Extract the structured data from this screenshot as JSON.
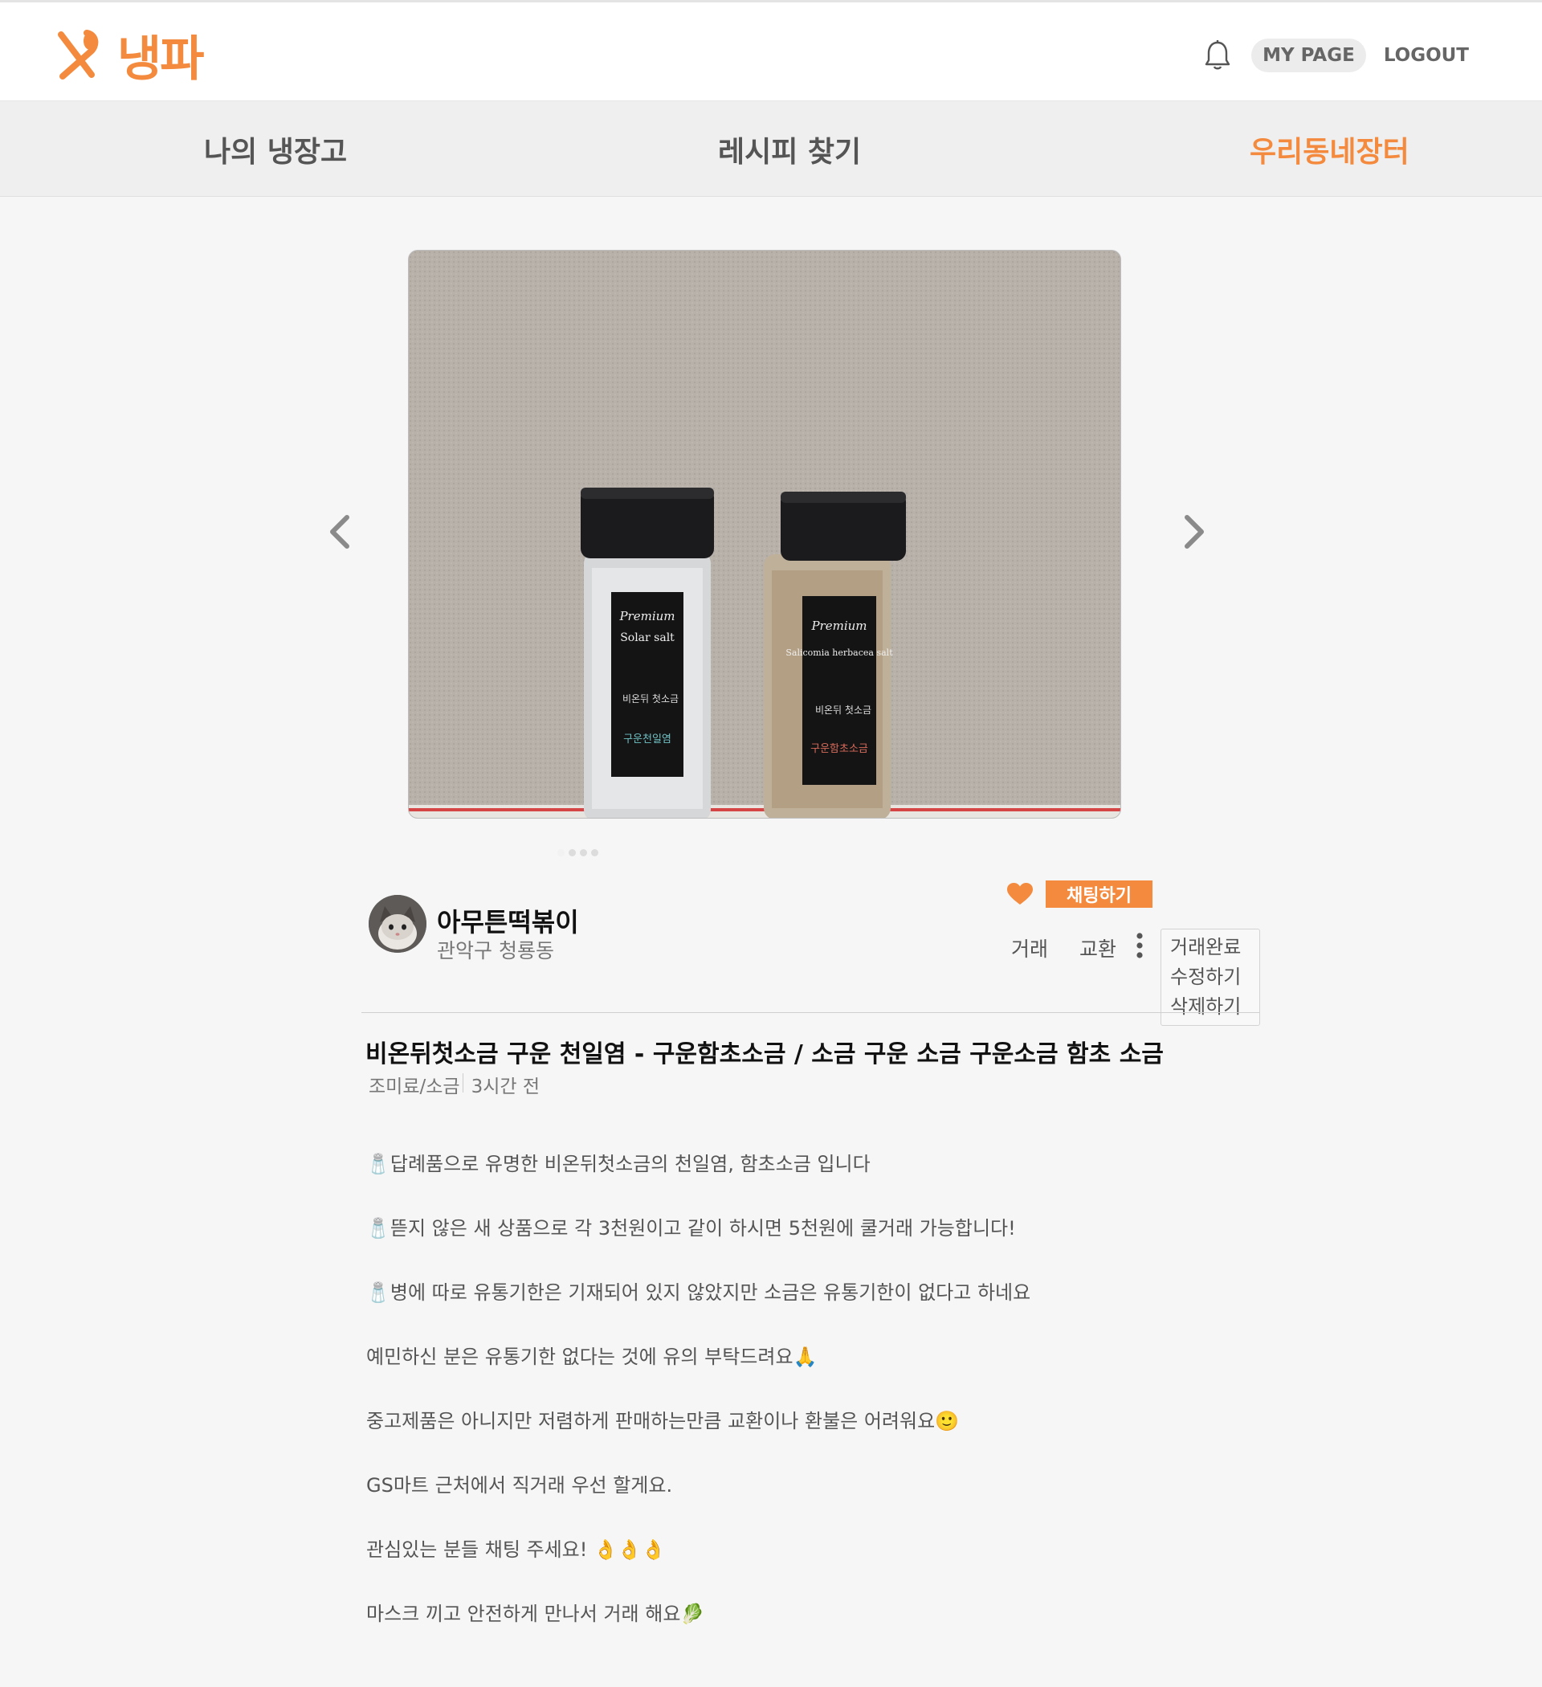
{
  "header": {
    "logo_text": "냉파",
    "mypage_label": "MY PAGE",
    "logout_label": "LOGOUT",
    "accent_color": "#f48a3d"
  },
  "nav": {
    "items": [
      {
        "label": "나의 냉장고",
        "active": false
      },
      {
        "label": "레시피 찾기",
        "active": false
      },
      {
        "label": "우리동네장터",
        "active": true
      }
    ]
  },
  "carousel": {
    "slides": 4,
    "current_slide": 1,
    "jar_labels": [
      {
        "line1": "Premium",
        "line2": "Solar salt",
        "brand": "비온뒤 첫소금",
        "name": "구운천일염"
      },
      {
        "line1": "Premium",
        "line2": "Salicomia herbacea salt",
        "brand": "비온뒤 첫소금",
        "name": "구운함초소금"
      }
    ]
  },
  "seller": {
    "name": "아무튼떡볶이",
    "location": "관악구 청룡동"
  },
  "actions": {
    "chat_label": "채팅하기",
    "tags": [
      "거래",
      "교환"
    ],
    "menu_items": [
      "거래완료",
      "수정하기",
      "삭제하기"
    ]
  },
  "post": {
    "title": "비온뒤첫소금 구운 천일염 - 구운함초소금 / 소금 구운 소금 구운소금 함초 소금",
    "category": "조미료/소금",
    "time": "3시간 전",
    "body": [
      "🧂답례품으로 유명한 비온뒤첫소금의 천일염, 함초소금 입니다",
      "🧂뜯지 않은 새 상품으로 각 3천원이고 같이 하시면 5천원에 쿨거래 가능합니다!",
      "🧂병에 따로 유통기한은 기재되어 있지 않았지만 소금은 유통기한이 없다고 하네요",
      "예민하신 분은 유통기한 없다는 것에 유의 부탁드려요🙏",
      "중고제품은 아니지만 저렴하게 판매하는만큼 교환이나 환불은 어려워요🙂",
      "GS마트 근처에서 직거래 우선 할게요.",
      "관심있는 분들 채팅 주세요! 👌👌👌",
      "마스크 끼고 안전하게 만나서 거래 해요🥬"
    ]
  }
}
